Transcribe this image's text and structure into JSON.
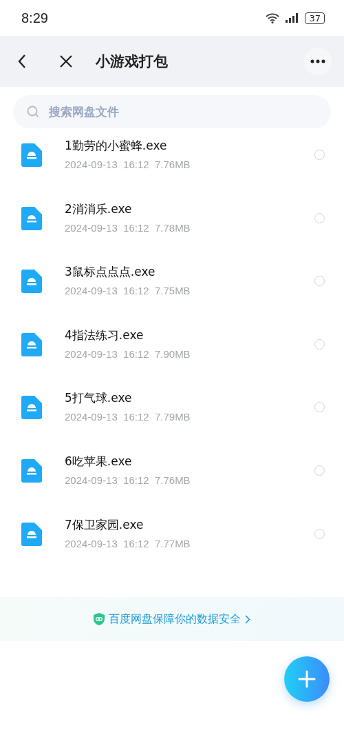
{
  "status_bar": {
    "time": "8:29",
    "battery": "37"
  },
  "header": {
    "title": "小游戏打包"
  },
  "search": {
    "placeholder": "搜索网盘文件"
  },
  "files": [
    {
      "name": "1勤劳的小蜜蜂.exe",
      "date": "2024-09-13",
      "time": "16:12",
      "size": "7.76MB",
      "selected": false
    },
    {
      "name": "2消消乐.exe",
      "date": "2024-09-13",
      "time": "16:12",
      "size": "7.78MB",
      "selected": false
    },
    {
      "name": "3鼠标点点点.exe",
      "date": "2024-09-13",
      "time": "16:12",
      "size": "7.75MB",
      "selected": false
    },
    {
      "name": "4指法练习.exe",
      "date": "2024-09-13",
      "time": "16:12",
      "size": "7.90MB",
      "selected": false
    },
    {
      "name": "5打气球.exe",
      "date": "2024-09-13",
      "time": "16:12",
      "size": "7.79MB",
      "selected": false
    },
    {
      "name": "6吃苹果.exe",
      "date": "2024-09-13",
      "time": "16:12",
      "size": "7.76MB",
      "selected": false
    },
    {
      "name": "7保卫家园.exe",
      "date": "2024-09-13",
      "time": "16:12",
      "size": "7.77MB",
      "selected": false
    }
  ],
  "banner": {
    "text": "百度网盘保障你的数据安全"
  }
}
